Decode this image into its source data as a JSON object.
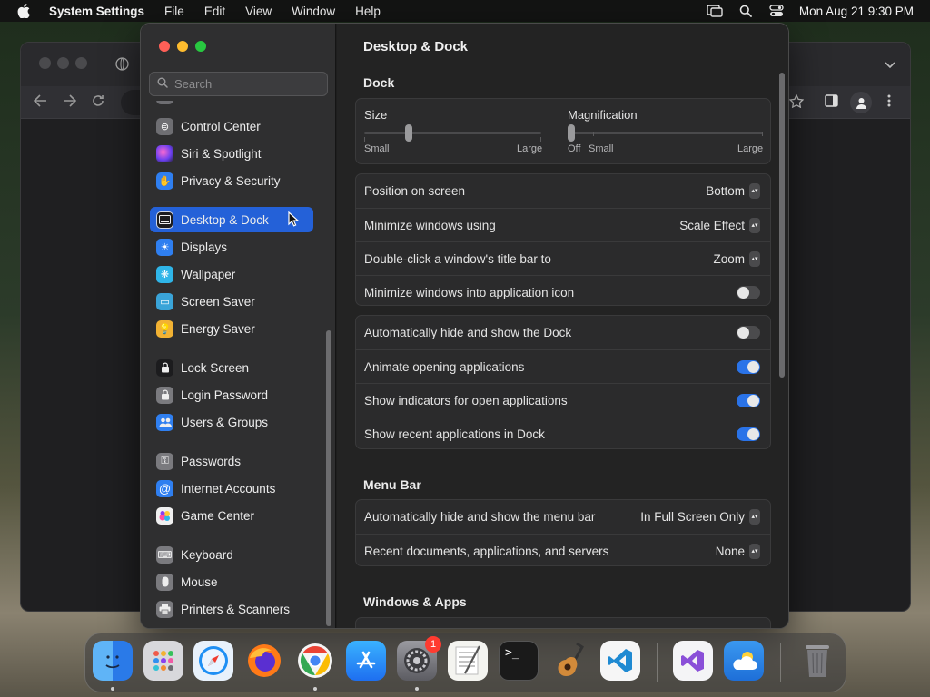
{
  "menubar": {
    "app_name": "System Settings",
    "menus": [
      "File",
      "Edit",
      "View",
      "Window",
      "Help"
    ],
    "clock": "Mon Aug 21  9:30 PM"
  },
  "search": {
    "placeholder": "Search"
  },
  "sidebar": {
    "items": [
      {
        "label": "Control Center",
        "icon": "control-center-icon",
        "color": "#6e6e72"
      },
      {
        "label": "Siri & Spotlight",
        "icon": "siri-icon",
        "color": "#8a3ff0"
      },
      {
        "label": "Privacy & Security",
        "icon": "hand-icon",
        "color": "#2f7ff0"
      },
      {
        "label": "Desktop & Dock",
        "icon": "dock-icon",
        "color": "#1c1c1e",
        "selected": true
      },
      {
        "label": "Displays",
        "icon": "sun-icon",
        "color": "#2f7ff0"
      },
      {
        "label": "Wallpaper",
        "icon": "flower-icon",
        "color": "#2fb5e8"
      },
      {
        "label": "Screen Saver",
        "icon": "screen-saver-icon",
        "color": "#3aa4d8"
      },
      {
        "label": "Energy Saver",
        "icon": "bulb-icon",
        "color": "#f2b233"
      },
      {
        "label": "Lock Screen",
        "icon": "lock-icon",
        "color": "#1c1c1e"
      },
      {
        "label": "Login Password",
        "icon": "lock-icon",
        "color": "#7a7a7e"
      },
      {
        "label": "Users & Groups",
        "icon": "users-icon",
        "color": "#2f7ff0"
      },
      {
        "label": "Passwords",
        "icon": "key-icon",
        "color": "#7a7a7e"
      },
      {
        "label": "Internet Accounts",
        "icon": "at-icon",
        "color": "#2f7ff0"
      },
      {
        "label": "Game Center",
        "icon": "game-center-icon",
        "color": "#f0f0f0"
      },
      {
        "label": "Keyboard",
        "icon": "keyboard-icon",
        "color": "#7a7a7e"
      },
      {
        "label": "Mouse",
        "icon": "mouse-icon",
        "color": "#7a7a7e"
      },
      {
        "label": "Printers & Scanners",
        "icon": "printer-icon",
        "color": "#7a7a7e"
      }
    ]
  },
  "content": {
    "title": "Desktop & Dock",
    "dock_section": "Dock",
    "size": {
      "label": "Size",
      "min_label": "Small",
      "max_label": "Large",
      "value": 0.25
    },
    "magnification": {
      "label": "Magnification",
      "off_label": "Off",
      "min_label": "Small",
      "max_label": "Large",
      "value": 0.0
    },
    "settings_group": [
      {
        "label": "Position on screen",
        "value": "Bottom"
      },
      {
        "label": "Minimize windows using",
        "value": "Scale Effect"
      },
      {
        "label": "Double-click a window's title bar to",
        "value": "Zoom"
      },
      {
        "label": "Minimize windows into application icon",
        "toggle": false
      }
    ],
    "toggle_group": [
      {
        "label": "Automatically hide and show the Dock",
        "toggle": false
      },
      {
        "label": "Animate opening applications",
        "toggle": true
      },
      {
        "label": "Show indicators for open applications",
        "toggle": true
      },
      {
        "label": "Show recent applications in Dock",
        "toggle": true
      }
    ],
    "menu_bar_section": "Menu Bar",
    "menu_bar_group": [
      {
        "label": "Automatically hide and show the menu bar",
        "value": "In Full Screen Only"
      },
      {
        "label": "Recent documents, applications, and servers",
        "value": "None"
      }
    ],
    "windows_apps_section": "Windows & Apps"
  },
  "dock": {
    "apps": [
      {
        "name": "finder-icon",
        "color": "#2a8ff0",
        "running": true
      },
      {
        "name": "launchpad-icon",
        "color": "#d8d8dc",
        "running": false
      },
      {
        "name": "safari-icon",
        "color": "#e8f1fb",
        "running": false
      },
      {
        "name": "firefox-icon",
        "color": "#6a2fc9",
        "running": false
      },
      {
        "name": "chrome-icon",
        "color": "#f4f4f4",
        "running": true
      },
      {
        "name": "app-store-icon",
        "color": "#1e8ff4",
        "running": false
      },
      {
        "name": "system-settings-icon",
        "color": "#7d7d82",
        "running": true,
        "badge": "1"
      },
      {
        "name": "textedit-icon",
        "color": "#f4f4f0",
        "running": false
      },
      {
        "name": "terminal-icon",
        "color": "#1a1a1a",
        "running": false
      },
      {
        "name": "garageband-icon",
        "color": "#2a2018",
        "running": false
      },
      {
        "name": "vscode-icon",
        "color": "#f6f6f6",
        "running": false
      },
      {
        "name": "visual-studio-icon",
        "color": "#f4f4f6",
        "running": false
      },
      {
        "name": "weather-icon",
        "color": "#2f8ce8",
        "running": false
      },
      {
        "name": "trash-icon",
        "color": "#6f6f72",
        "running": false
      }
    ]
  }
}
